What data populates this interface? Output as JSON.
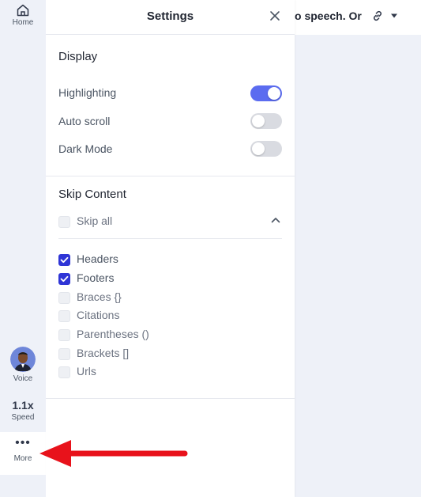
{
  "rail": {
    "home_label": "Home",
    "voice_label": "Voice",
    "speed_value": "1.1x",
    "speed_label": "Speed",
    "more_dots": "•••",
    "more_label": "More"
  },
  "header": {
    "doc_title": "o speech. Or"
  },
  "settings": {
    "title": "Settings",
    "display": {
      "title": "Display",
      "rows": [
        {
          "label": "Highlighting",
          "on": true
        },
        {
          "label": "Auto scroll",
          "on": false
        },
        {
          "label": "Dark Mode",
          "on": false
        }
      ]
    },
    "skip": {
      "title": "Skip Content",
      "skip_all": "Skip all",
      "items": [
        {
          "label": "Headers",
          "checked": true
        },
        {
          "label": "Footers",
          "checked": true
        },
        {
          "label": "Braces {}",
          "checked": false
        },
        {
          "label": "Citations",
          "checked": false
        },
        {
          "label": "Parentheses ()",
          "checked": false
        },
        {
          "label": "Brackets []",
          "checked": false
        },
        {
          "label": "Urls",
          "checked": false
        }
      ]
    }
  },
  "colors": {
    "accent": "#5b6cf0",
    "checkbox": "#2f35d6",
    "arrow": "#e8121b",
    "rail_bg": "#eef1f8"
  }
}
